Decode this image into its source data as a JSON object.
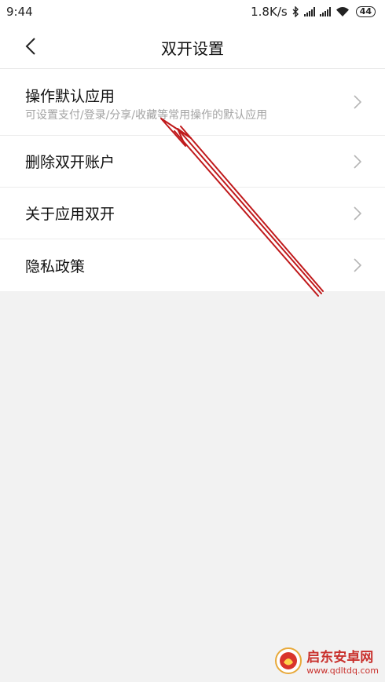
{
  "status": {
    "time": "9:44",
    "speed": "1.8K/s",
    "battery": "44"
  },
  "header": {
    "title": "双开设置"
  },
  "menu": {
    "items": [
      {
        "label": "操作默认应用",
        "desc": "可设置支付/登录/分享/收藏等常用操作的默认应用"
      },
      {
        "label": "删除双开账户"
      },
      {
        "label": "关于应用双开"
      },
      {
        "label": "隐私政策"
      }
    ]
  },
  "watermark": {
    "title": "启东安卓网",
    "url": "www.qdltdq.com"
  },
  "colors": {
    "annotation_arrow": "#c0191b",
    "background": "#f2f2f2",
    "card": "#ffffff"
  }
}
